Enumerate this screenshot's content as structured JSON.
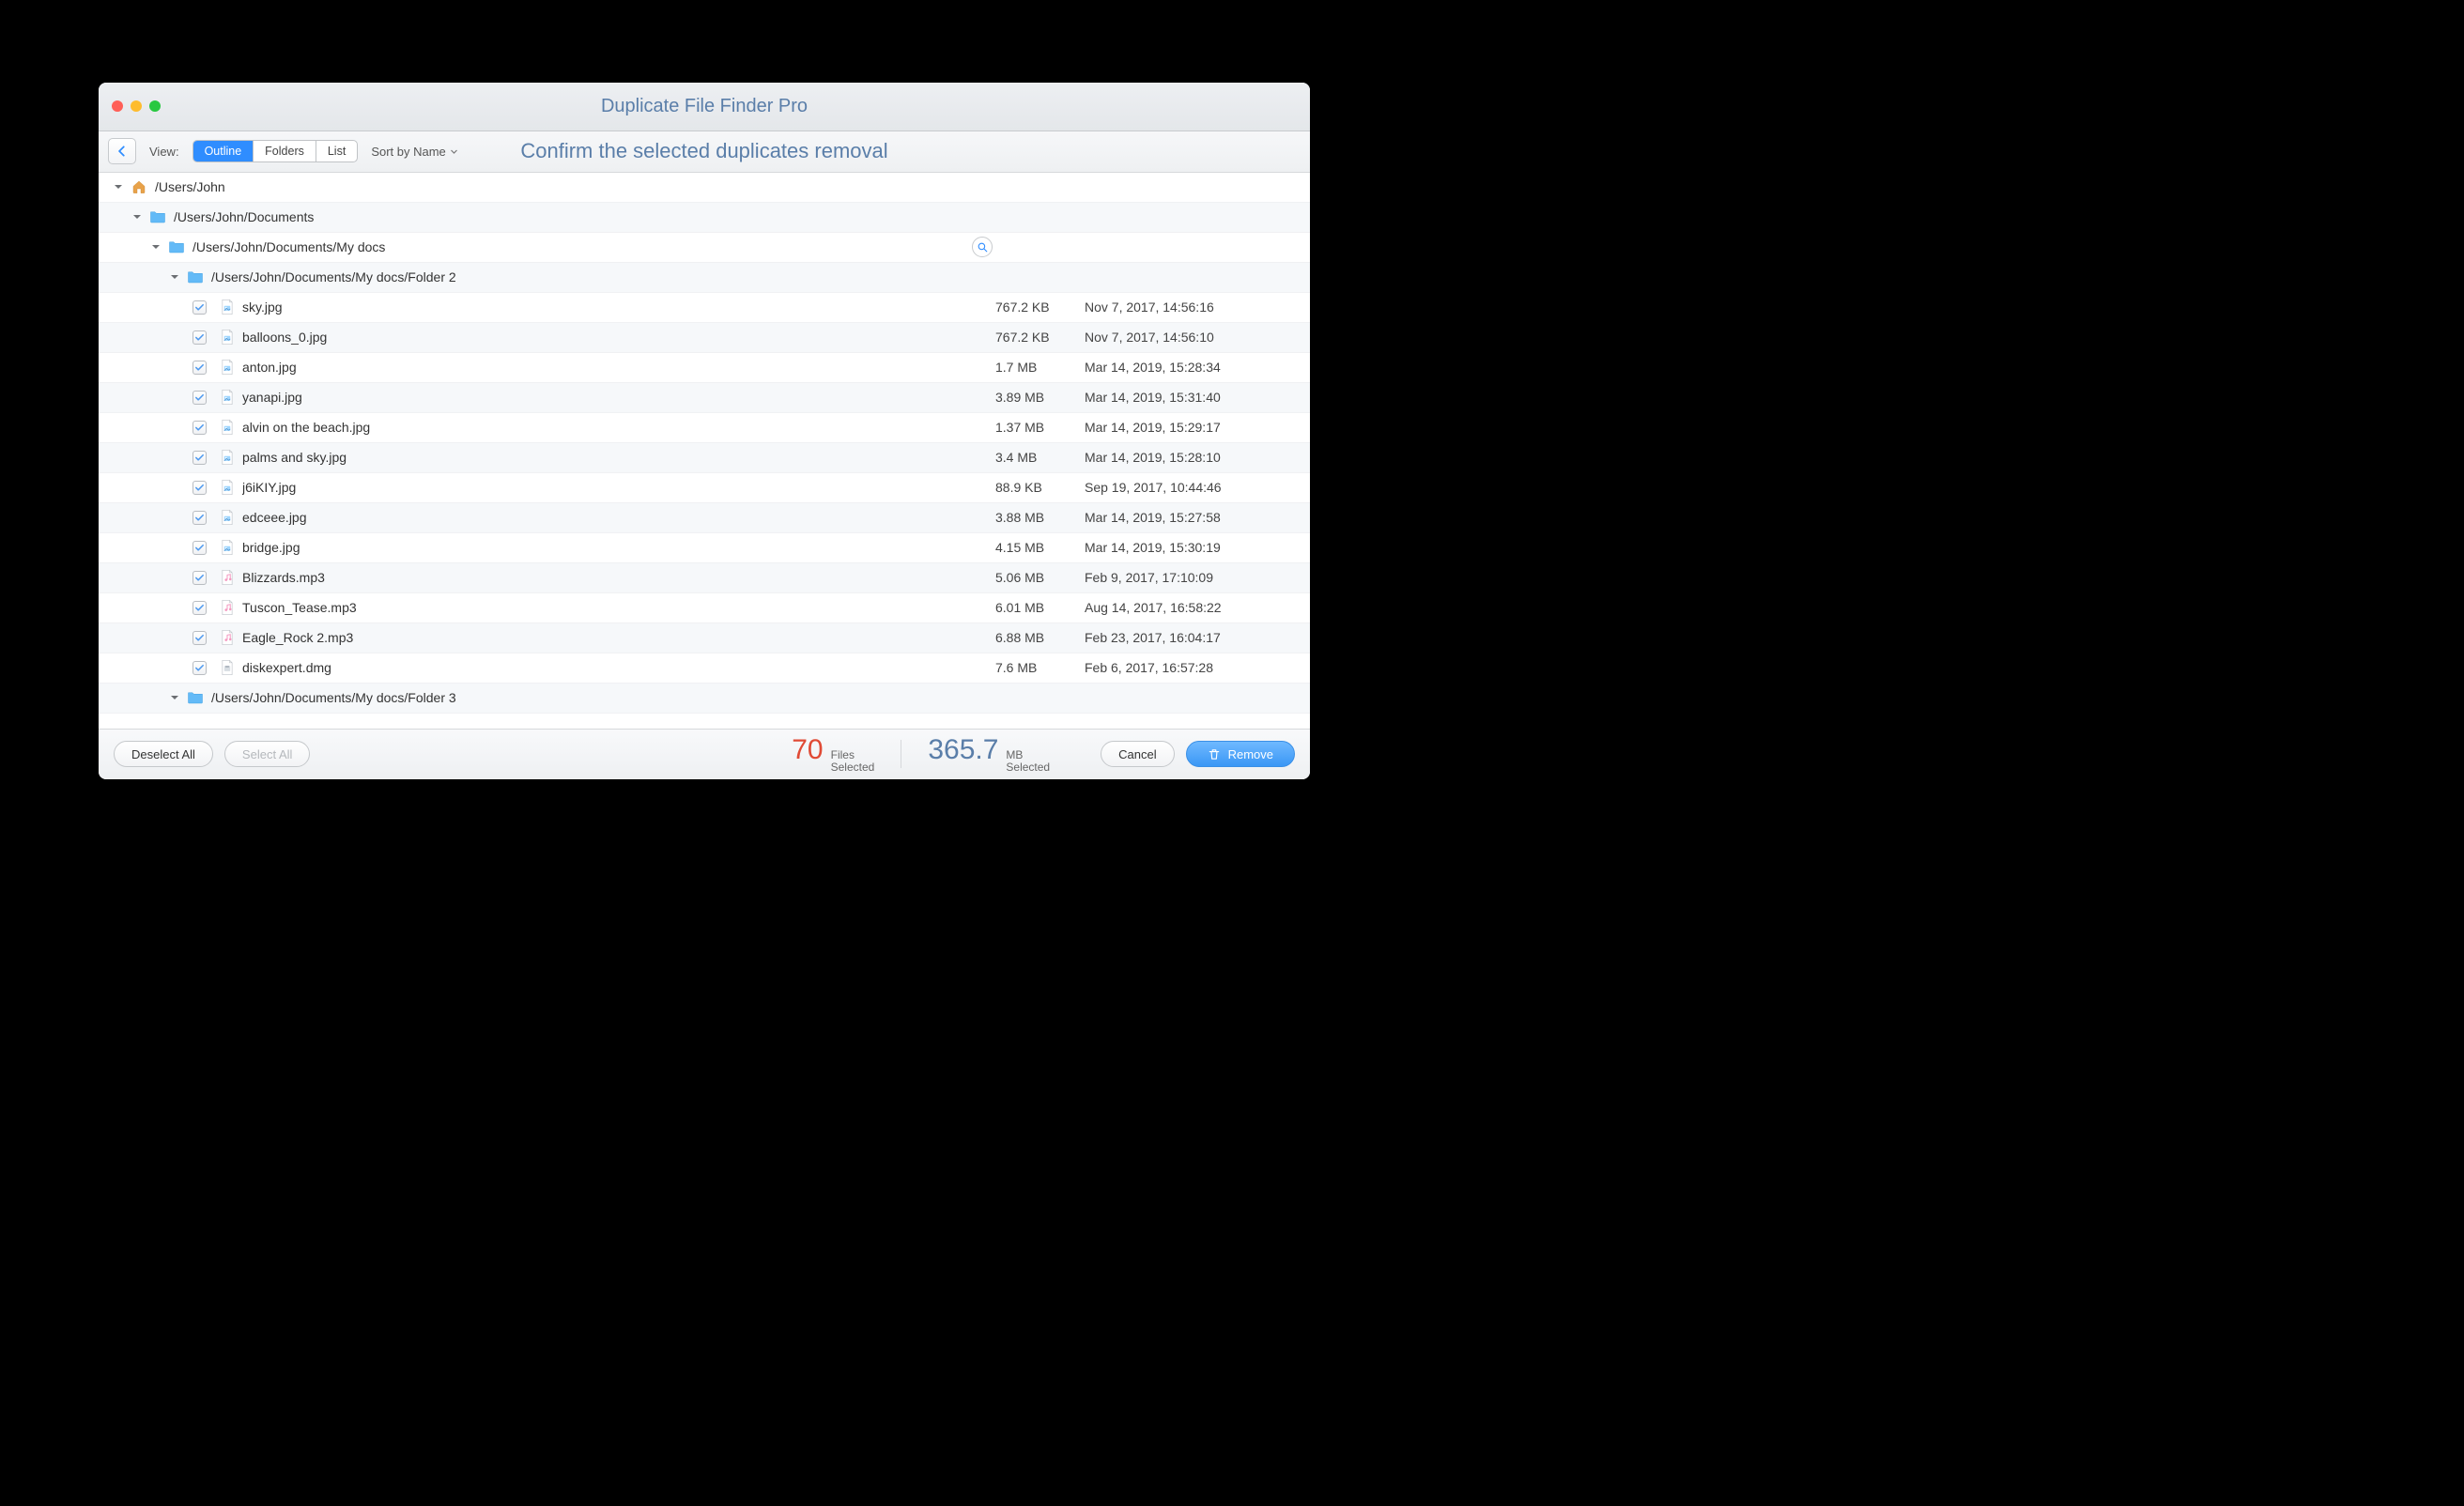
{
  "titlebar": {
    "title": "Duplicate File Finder Pro"
  },
  "toolbar": {
    "view_label": "View:",
    "seg_outline": "Outline",
    "seg_folders": "Folders",
    "seg_list": "List",
    "sort_label": "Sort by Name",
    "headline": "Confirm the selected duplicates removal"
  },
  "tree": {
    "root": {
      "path": "/Users/John"
    },
    "level1": {
      "path": "/Users/John/Documents"
    },
    "level2": {
      "path": "/Users/John/Documents/My docs"
    },
    "level3": {
      "path": "/Users/John/Documents/My docs/Folder 2"
    },
    "level3b": {
      "path": "/Users/John/Documents/My docs/Folder 3"
    }
  },
  "files": [
    {
      "name": "sky.jpg",
      "size": "767.2 KB",
      "date": "Nov 7, 2017, 14:56:16",
      "kind": "image"
    },
    {
      "name": "balloons_0.jpg",
      "size": "767.2 KB",
      "date": "Nov 7, 2017, 14:56:10",
      "kind": "image"
    },
    {
      "name": "anton.jpg",
      "size": "1.7 MB",
      "date": "Mar 14, 2019, 15:28:34",
      "kind": "image"
    },
    {
      "name": "yanapi.jpg",
      "size": "3.89 MB",
      "date": "Mar 14, 2019, 15:31:40",
      "kind": "image"
    },
    {
      "name": "alvin on the beach.jpg",
      "size": "1.37 MB",
      "date": "Mar 14, 2019, 15:29:17",
      "kind": "image"
    },
    {
      "name": "palms and sky.jpg",
      "size": "3.4 MB",
      "date": "Mar 14, 2019, 15:28:10",
      "kind": "image"
    },
    {
      "name": "j6iKIY.jpg",
      "size": "88.9 KB",
      "date": "Sep 19, 2017, 10:44:46",
      "kind": "image"
    },
    {
      "name": "edceee.jpg",
      "size": "3.88 MB",
      "date": "Mar 14, 2019, 15:27:58",
      "kind": "image"
    },
    {
      "name": "bridge.jpg",
      "size": "4.15 MB",
      "date": "Mar 14, 2019, 15:30:19",
      "kind": "image"
    },
    {
      "name": "Blizzards.mp3",
      "size": "5.06 MB",
      "date": "Feb 9, 2017, 17:10:09",
      "kind": "audio"
    },
    {
      "name": "Tuscon_Tease.mp3",
      "size": "6.01 MB",
      "date": "Aug 14, 2017, 16:58:22",
      "kind": "audio"
    },
    {
      "name": "Eagle_Rock 2.mp3",
      "size": "6.88 MB",
      "date": "Feb 23, 2017, 16:04:17",
      "kind": "audio"
    },
    {
      "name": "diskexpert.dmg",
      "size": "7.6 MB",
      "date": "Feb 6, 2017, 16:57:28",
      "kind": "disk"
    }
  ],
  "footer": {
    "deselect": "Deselect All",
    "select": "Select All",
    "cancel": "Cancel",
    "remove": "Remove",
    "files_count": "70",
    "files_unit_top": "Files",
    "files_unit_bottom": "Selected",
    "size_count": "365.7",
    "size_unit_top": "MB",
    "size_unit_bottom": "Selected"
  }
}
